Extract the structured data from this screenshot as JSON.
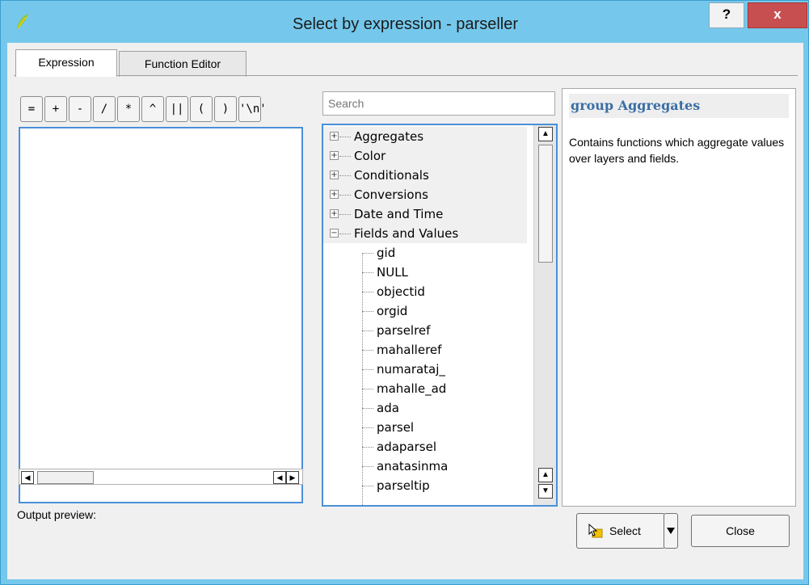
{
  "window": {
    "title": "Select by expression - parseller",
    "help_label": "?",
    "close_label": "x"
  },
  "tabs": [
    {
      "label": "Expression",
      "active": true
    },
    {
      "label": "Function Editor",
      "active": false
    }
  ],
  "operators": [
    "=",
    "+",
    "-",
    "/",
    "*",
    "^",
    "||",
    "(",
    ")",
    "'\\n'"
  ],
  "expression": {
    "value": "",
    "output_label": "Output preview:"
  },
  "search": {
    "placeholder": "Search"
  },
  "tree": {
    "groups": [
      {
        "label": "Aggregates",
        "expanded": false
      },
      {
        "label": "Color",
        "expanded": false
      },
      {
        "label": "Conditionals",
        "expanded": false
      },
      {
        "label": "Conversions",
        "expanded": false
      },
      {
        "label": "Date and Time",
        "expanded": false
      },
      {
        "label": "Fields and Values",
        "expanded": true
      }
    ],
    "fields": [
      "gid",
      "NULL",
      "objectid",
      "orgid",
      "parselref",
      "mahalleref",
      "numarataj_",
      "mahalle_ad",
      "ada",
      "parsel",
      "adaparsel",
      "anatasinma",
      "parseltip"
    ]
  },
  "help": {
    "title": "group Aggregates",
    "body": "Contains functions which aggregate values over layers and fields."
  },
  "buttons": {
    "select": "Select",
    "close": "Close"
  },
  "colors": {
    "frame": "#75c8ec",
    "close_button": "#c74f50",
    "focus_border": "#4a90d9",
    "help_title": "#3a6ea5"
  }
}
